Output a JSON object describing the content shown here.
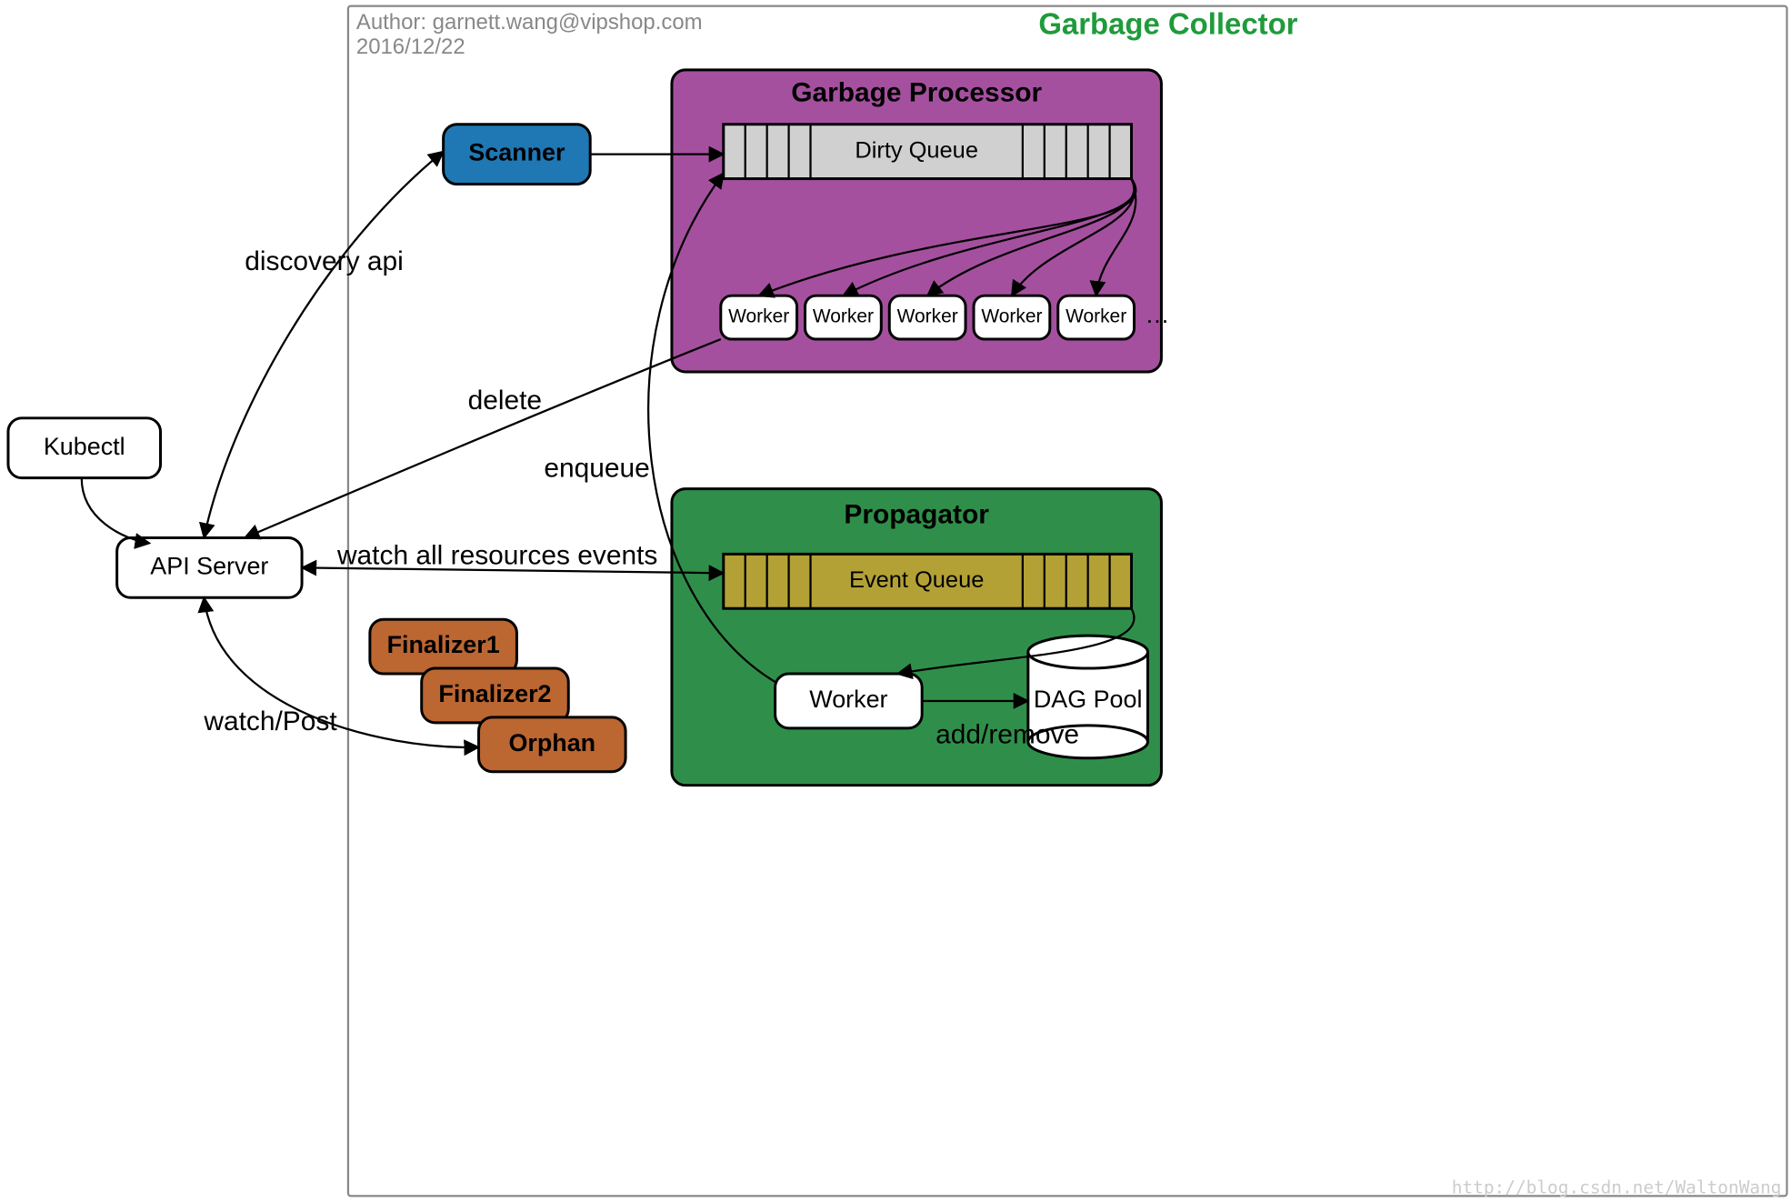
{
  "author": "Author: garnett.wang@vipshop.com",
  "date": "2016/12/22",
  "title": "Garbage Collector",
  "nodes": {
    "kubectl": "Kubectl",
    "api_server": "API Server",
    "scanner": "Scanner",
    "finalizer1": "Finalizer1",
    "finalizer2": "Finalizer2",
    "orphan": "Orphan",
    "gp_title": "Garbage Processor",
    "dirty_queue": "Dirty Queue",
    "gp_workers": [
      "Worker",
      "Worker",
      "Worker",
      "Worker",
      "Worker"
    ],
    "gp_ellipsis": "…",
    "prop_title": "Propagator",
    "event_queue": "Event Queue",
    "prop_worker": "Worker",
    "dag_pool": "DAG Pool"
  },
  "edges": {
    "discovery_api": "discovery api",
    "delete": "delete",
    "enqueue": "enqueue",
    "watch_all": "watch all resources events",
    "watch_post": "watch/Post",
    "add_remove": "add/remove"
  },
  "watermark": "http://blog.csdn.net/WaltonWang",
  "colors": {
    "title": "#1e9b3a",
    "scanner_fill": "#1f78b4",
    "gp_fill": "#a5509f",
    "prop_fill": "#2f8f4a",
    "finalizer_fill": "#bc6631"
  }
}
